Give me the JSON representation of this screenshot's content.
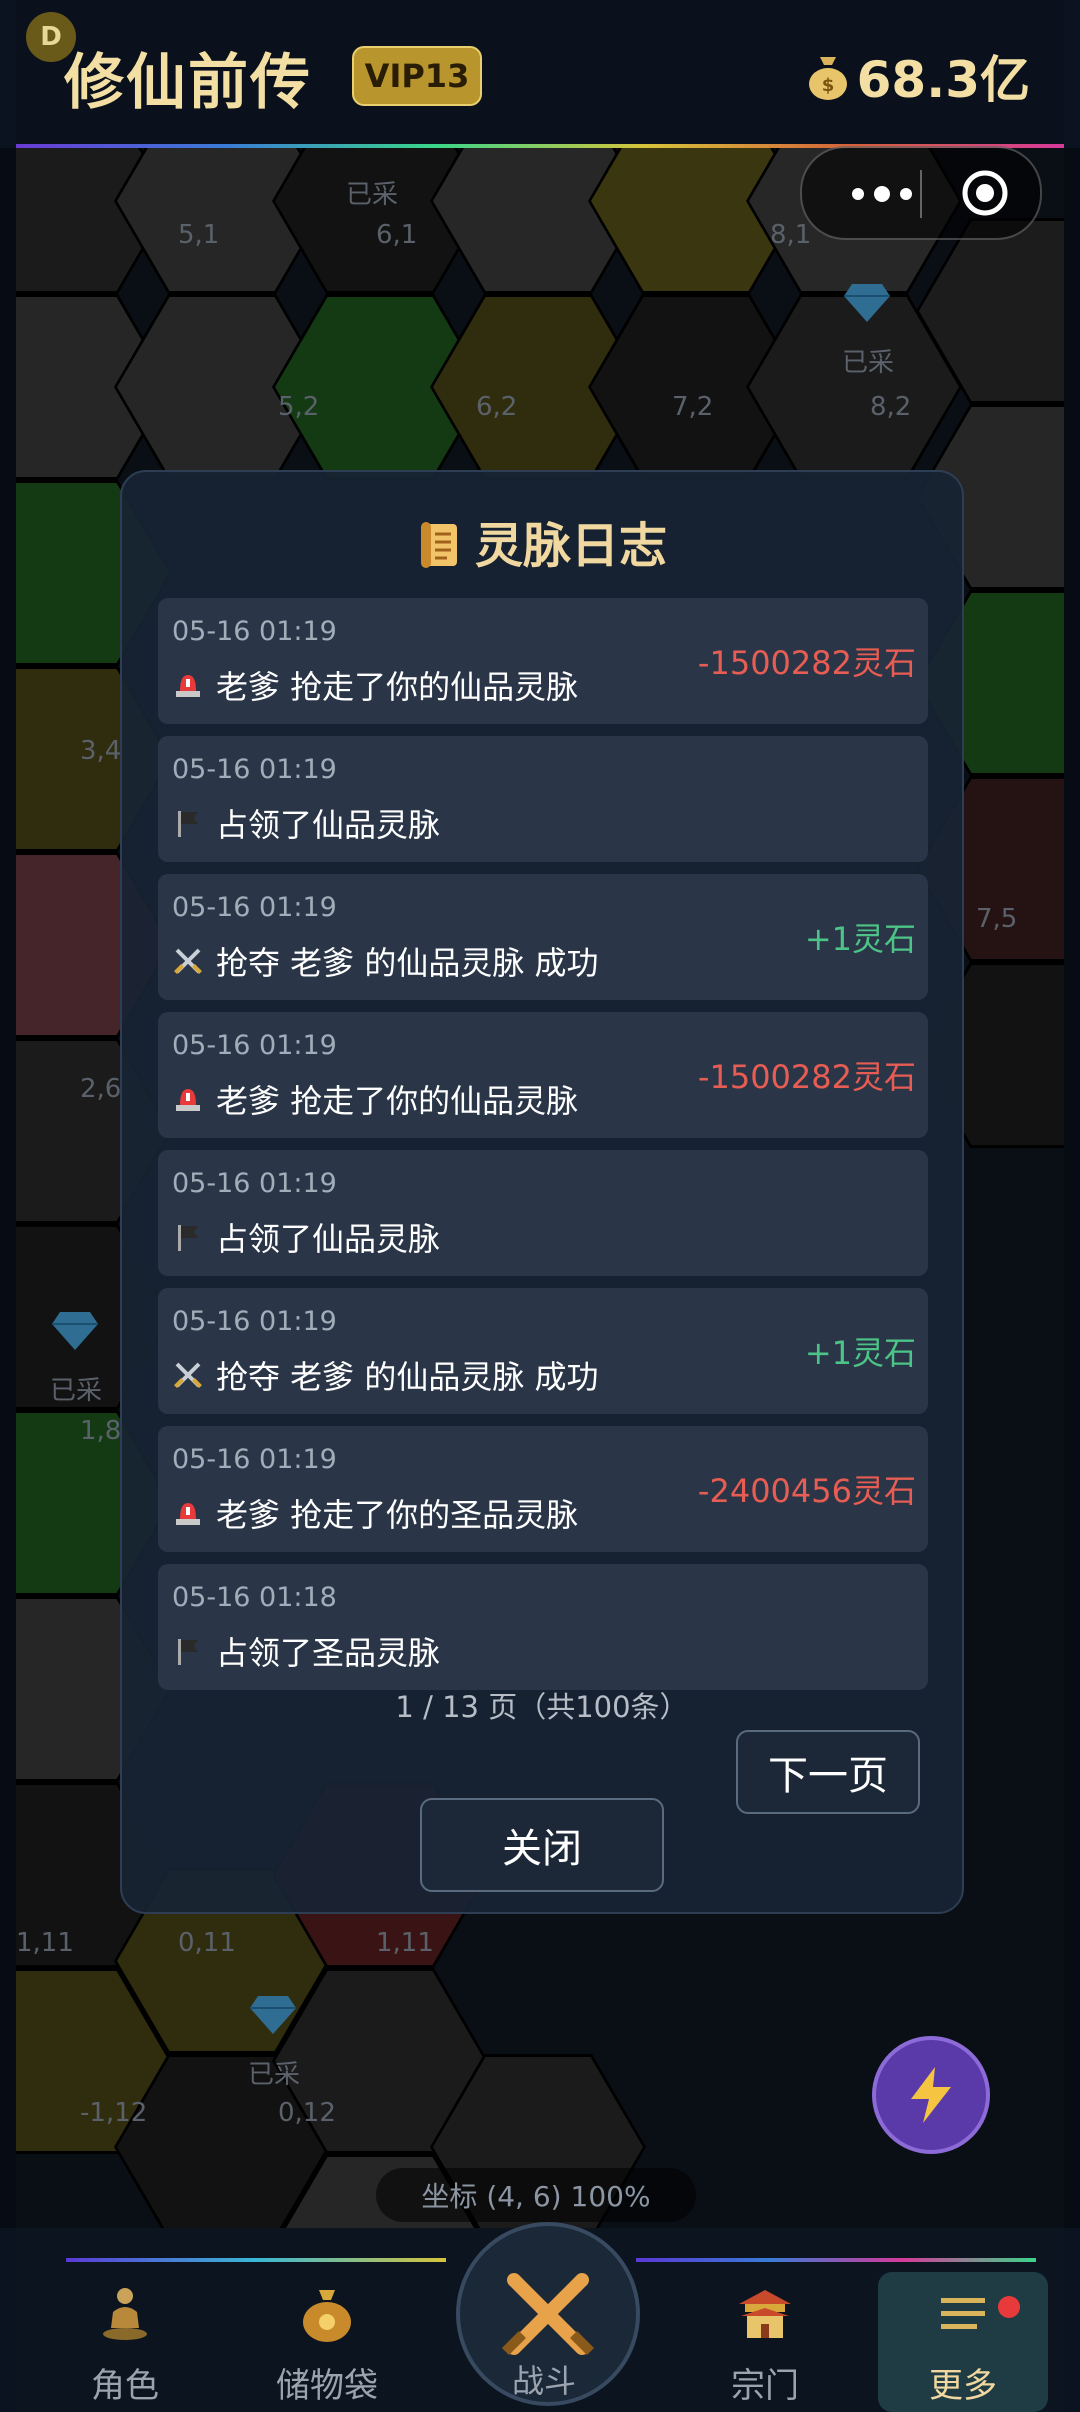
{
  "header": {
    "badge": "D",
    "title": "修仙前传",
    "vip": "VIP13",
    "money": "68.3亿"
  },
  "map": {
    "coords": [
      "5,1",
      "6,1",
      "8,1",
      "5,2",
      "6,2",
      "7,2",
      "8,2",
      "3,4",
      "7,5",
      "2,6",
      "1,8",
      "1,11",
      "0,11",
      "1,11",
      "-1,12",
      "0,12"
    ],
    "collected_label": "已采",
    "coord_readout": "坐标 (4, 6)  100%"
  },
  "modal": {
    "title": "灵脉日志",
    "entries": [
      {
        "time": "05-16 01:19",
        "text": "老爹 抢走了你的仙品灵脉",
        "amount": "-1500282灵石",
        "kind": "alarm",
        "sign": "neg"
      },
      {
        "time": "05-16 01:19",
        "text": "占领了仙品灵脉",
        "amount": "",
        "kind": "flag",
        "sign": ""
      },
      {
        "time": "05-16 01:19",
        "text": "抢夺 老爹 的仙品灵脉 成功",
        "amount": "+1灵石",
        "kind": "swords",
        "sign": "pos"
      },
      {
        "time": "05-16 01:19",
        "text": "老爹 抢走了你的仙品灵脉",
        "amount": "-1500282灵石",
        "kind": "alarm",
        "sign": "neg"
      },
      {
        "time": "05-16 01:19",
        "text": "占领了仙品灵脉",
        "amount": "",
        "kind": "flag",
        "sign": ""
      },
      {
        "time": "05-16 01:19",
        "text": "抢夺 老爹 的仙品灵脉 成功",
        "amount": "+1灵石",
        "kind": "swords",
        "sign": "pos"
      },
      {
        "time": "05-16 01:19",
        "text": "老爹 抢走了你的圣品灵脉",
        "amount": "-2400456灵石",
        "kind": "alarm",
        "sign": "neg"
      },
      {
        "time": "05-16 01:18",
        "text": "占领了圣品灵脉",
        "amount": "",
        "kind": "flag",
        "sign": ""
      }
    ],
    "page_info": "1 / 13 页（共100条）",
    "next_label": "下一页",
    "close_label": "关闭"
  },
  "nav": {
    "role": "角色",
    "bag": "储物袋",
    "battle": "战斗",
    "sect": "宗门",
    "more": "更多"
  },
  "colors": {
    "gold": "#f3dfa4",
    "negative": "#e85d53",
    "positive": "#4cc487"
  }
}
